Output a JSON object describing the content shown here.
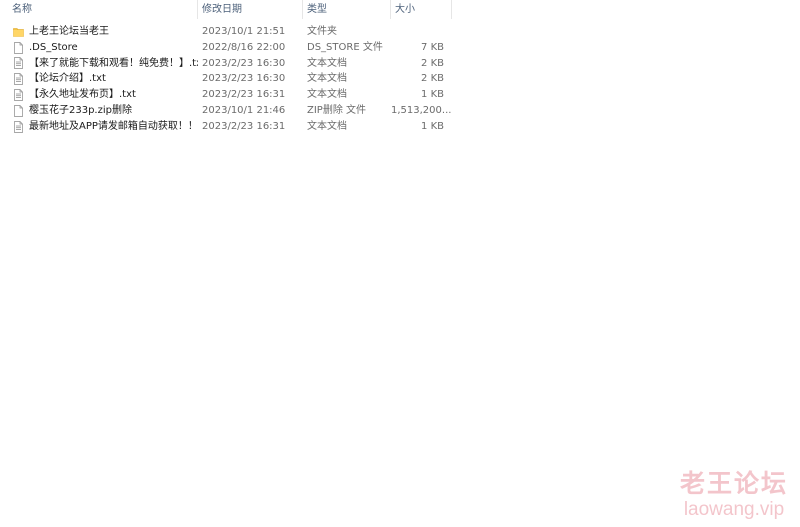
{
  "columns": {
    "name": "名称",
    "date": "修改日期",
    "type": "类型",
    "size": "大小",
    "sort_indicator": "^"
  },
  "files": [
    {
      "name": "上老王论坛当老王",
      "date": "2023/10/1 21:51",
      "type": "文件夹",
      "size": "",
      "icon": "folder-icon"
    },
    {
      "name": ".DS_Store",
      "date": "2022/8/16 22:00",
      "type": "DS_STORE 文件",
      "size": "7 KB",
      "icon": "file-icon"
    },
    {
      "name": "【来了就能下载和观看！纯免费！】.txt",
      "date": "2023/2/23 16:30",
      "type": "文本文档",
      "size": "2 KB",
      "icon": "text-file-icon"
    },
    {
      "name": "【论坛介绍】.txt",
      "date": "2023/2/23 16:30",
      "type": "文本文档",
      "size": "2 KB",
      "icon": "text-file-icon"
    },
    {
      "name": "【永久地址发布页】.txt",
      "date": "2023/2/23 16:31",
      "type": "文本文档",
      "size": "1 KB",
      "icon": "text-file-icon"
    },
    {
      "name": "樱玉花子233p.zip删除",
      "date": "2023/10/1 21:46",
      "type": "ZIP删除 文件",
      "size": "1,513,200...",
      "icon": "file-icon"
    },
    {
      "name": "最新地址及APP请发邮箱自动获取！！！...",
      "date": "2023/2/23 16:31",
      "type": "文本文档",
      "size": "1 KB",
      "icon": "text-file-icon"
    }
  ],
  "watermark": {
    "title": "老王论坛",
    "url": "laowang.vip"
  },
  "colors": {
    "folder": "#f5c342",
    "header_text": "#4c607a",
    "watermark": "#e996a0"
  }
}
